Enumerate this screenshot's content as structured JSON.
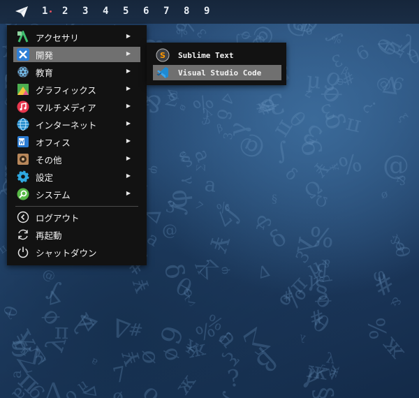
{
  "topbar": {
    "launcher_icon": "paper-plane-icon",
    "workspaces": [
      "1",
      "2",
      "3",
      "4",
      "5",
      "6",
      "7",
      "8",
      "9"
    ],
    "active_workspace": "1"
  },
  "menu": {
    "categories": [
      {
        "label": "アクセサリ",
        "icon": "accessories-icon"
      },
      {
        "label": "開発",
        "icon": "development-icon"
      },
      {
        "label": "教育",
        "icon": "education-icon"
      },
      {
        "label": "グラフィックス",
        "icon": "graphics-icon"
      },
      {
        "label": "マルチメディア",
        "icon": "multimedia-icon"
      },
      {
        "label": "インターネット",
        "icon": "internet-icon"
      },
      {
        "label": "オフィス",
        "icon": "office-icon"
      },
      {
        "label": "その他",
        "icon": "other-icon"
      },
      {
        "label": "設定",
        "icon": "settings-icon"
      },
      {
        "label": "システム",
        "icon": "system-icon"
      }
    ],
    "active_category": "開発",
    "actions": [
      {
        "label": "ログアウト",
        "icon": "logout-icon"
      },
      {
        "label": "再起動",
        "icon": "restart-icon"
      },
      {
        "label": "シャットダウン",
        "icon": "shutdown-icon"
      }
    ],
    "submenu_arrow": "▶"
  },
  "submenu": {
    "items": [
      {
        "label": "Sublime Text",
        "icon": "sublime-text-icon"
      },
      {
        "label": "Visual Studio Code",
        "icon": "vscode-icon"
      }
    ],
    "active_item": "Visual Studio Code"
  },
  "colors": {
    "menu_bg": "#121212",
    "highlight": "#707070",
    "notification_dot": "#e05060"
  }
}
